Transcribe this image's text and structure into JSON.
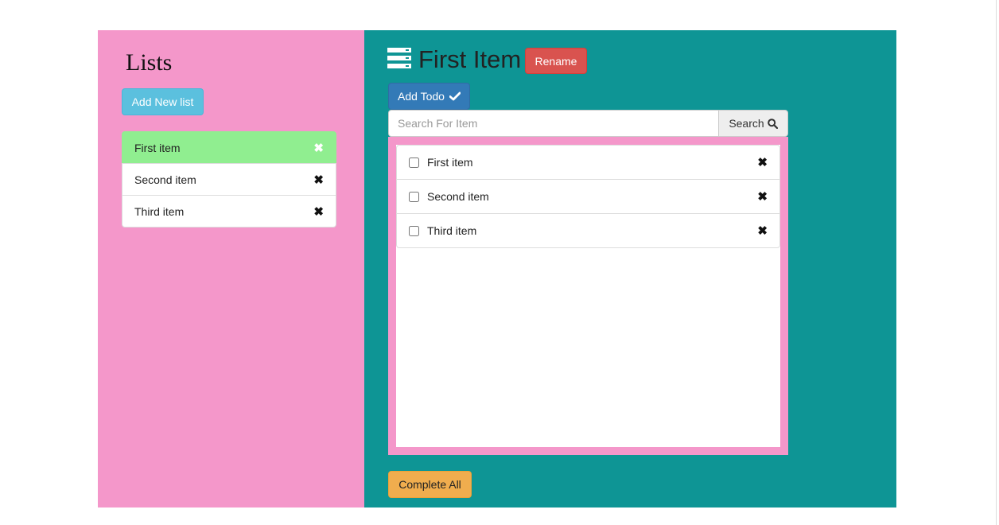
{
  "sidebar": {
    "title": "Lists",
    "add_button_label": "Add New list",
    "items": [
      {
        "label": "First item",
        "active": true,
        "delete_icon": "close-icon"
      },
      {
        "label": "Second item",
        "active": false,
        "delete_icon": "close-icon"
      },
      {
        "label": "Third item",
        "active": false,
        "delete_icon": "close-icon"
      }
    ]
  },
  "main": {
    "title_icon": "list-icon",
    "title": "First Item",
    "rename_label": "Rename",
    "add_todo_label": "Add Todo",
    "add_todo_icon": "check-icon",
    "search": {
      "placeholder": "Search For Item",
      "value": "",
      "button_label": "Search",
      "button_icon": "search-icon"
    },
    "todos": [
      {
        "label": "First item",
        "checked": false
      },
      {
        "label": "Second item",
        "checked": false
      },
      {
        "label": "Third item",
        "checked": false
      }
    ],
    "complete_all_label": "Complete All"
  },
  "colors": {
    "sidebar_bg": "#f497ca",
    "main_bg": "#0e9595",
    "active_item": "#90ee90",
    "info_button": "#5bc0de",
    "primary_button": "#337ab7",
    "danger_button": "#d9534f",
    "warning_button": "#f0ad4e"
  }
}
